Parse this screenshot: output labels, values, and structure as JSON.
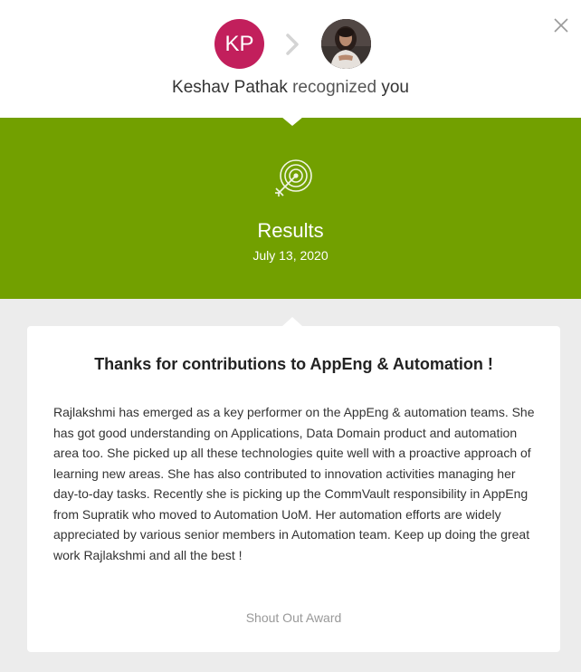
{
  "header": {
    "sender_initials": "KP",
    "sender_name": "Keshav Pathak",
    "verb": "recognized",
    "recipient": "you",
    "close_icon": "close-icon",
    "arrow_icon": "chevron-right-icon",
    "sender_avatar_color": "#c21f5c"
  },
  "banner": {
    "icon": "target-icon",
    "title": "Results",
    "date": "July 13, 2020",
    "background": "#72a000"
  },
  "card": {
    "title": "Thanks for contributions to AppEng & Automation !",
    "message": "Rajlakshmi has emerged as a key performer on the AppEng & automation teams. She has got good understanding on Applications, Data Domain product and automation area too. She picked up all these technologies quite well with a proactive approach of learning new areas. She has also contributed to innovation activities managing her day-to-day tasks. Recently she is picking up the CommVault responsibility in AppEng from Supratik who moved to Automation UoM. Her automation efforts are widely appreciated by various senior members in Automation team. Keep up doing the great work Rajlakshmi and all the best !",
    "award": "Shout Out Award"
  }
}
